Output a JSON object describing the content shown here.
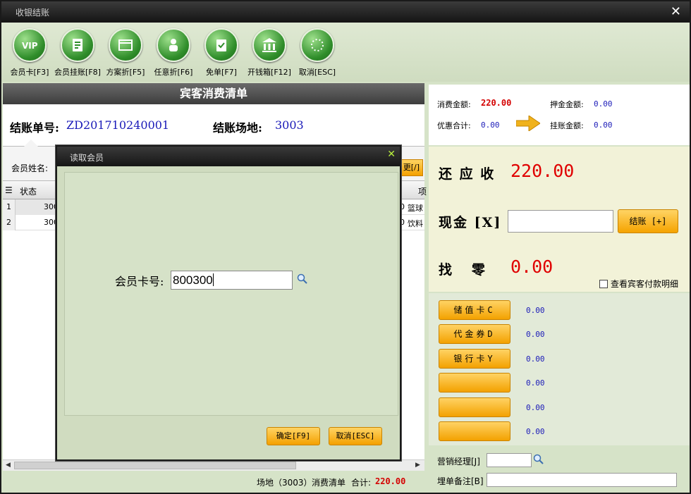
{
  "window": {
    "title": "收银结账"
  },
  "toolbar": {
    "items": [
      {
        "label": "会员卡[F3]"
      },
      {
        "label": "会员挂账[F8]"
      },
      {
        "label": "方案折[F5]"
      },
      {
        "label": "任意折[F6]"
      },
      {
        "label": "免单[F7]"
      },
      {
        "label": "开钱箱[F12]"
      },
      {
        "label": "取消[ESC]"
      }
    ]
  },
  "bill": {
    "header": "宾客消费清单",
    "bill_no_label": "结账单号:",
    "bill_no": "ZD201710240001",
    "venue_label": "结账场地:",
    "venue": "3003",
    "member_name_label": "会员姓名:",
    "member_btn_label": "更[/]"
  },
  "grid": {
    "columns": [
      "状态",
      "项"
    ],
    "rows": [
      {
        "idx": "1",
        "code": "300",
        "amount": "0",
        "item": "篮球"
      },
      {
        "idx": "2",
        "code": "300",
        "amount": "0",
        "item": "饮料"
      }
    ]
  },
  "footer": {
    "venue": "场地（3003）",
    "list": "消费清单",
    "total_label": "合计:",
    "total": "220.00"
  },
  "summary": {
    "consume_label": "消费金额:",
    "consume": "220.00",
    "deposit_label": "押金金额:",
    "deposit": "0.00",
    "discount_label": "优惠合计:",
    "discount": "0.00",
    "credit_label": "挂账金额:",
    "credit": "0.00"
  },
  "payment": {
    "due_label": "还 应 收",
    "due": "220.00",
    "cash_label": "现金 [X]",
    "cash_value": "",
    "settle_label": "结账 [+]",
    "change_label": "找   零",
    "change": "0.00",
    "detail_label": "查看宾客付款明细"
  },
  "methods": [
    {
      "label": "储值卡C",
      "value": "0.00"
    },
    {
      "label": "代金券D",
      "value": "0.00"
    },
    {
      "label": "银行卡Y",
      "value": "0.00"
    },
    {
      "label": "",
      "value": "0.00"
    },
    {
      "label": "",
      "value": "0.00"
    },
    {
      "label": "",
      "value": "0.00"
    }
  ],
  "bottom": {
    "manager_label": "营销经理[J]",
    "manager_value": "",
    "remark_label": "埋单备注[B]",
    "remark_value": ""
  },
  "modal": {
    "title": "读取会员",
    "card_label": "会员卡号:",
    "card_value": "800300",
    "ok_label": "确定[F9]",
    "cancel_label": "取消[ESC]"
  },
  "colors": {
    "accent_orange": "#f4a000",
    "amount_red": "#e00000",
    "value_blue": "#1a1ab8",
    "panel_green": "#d6e3c8"
  }
}
